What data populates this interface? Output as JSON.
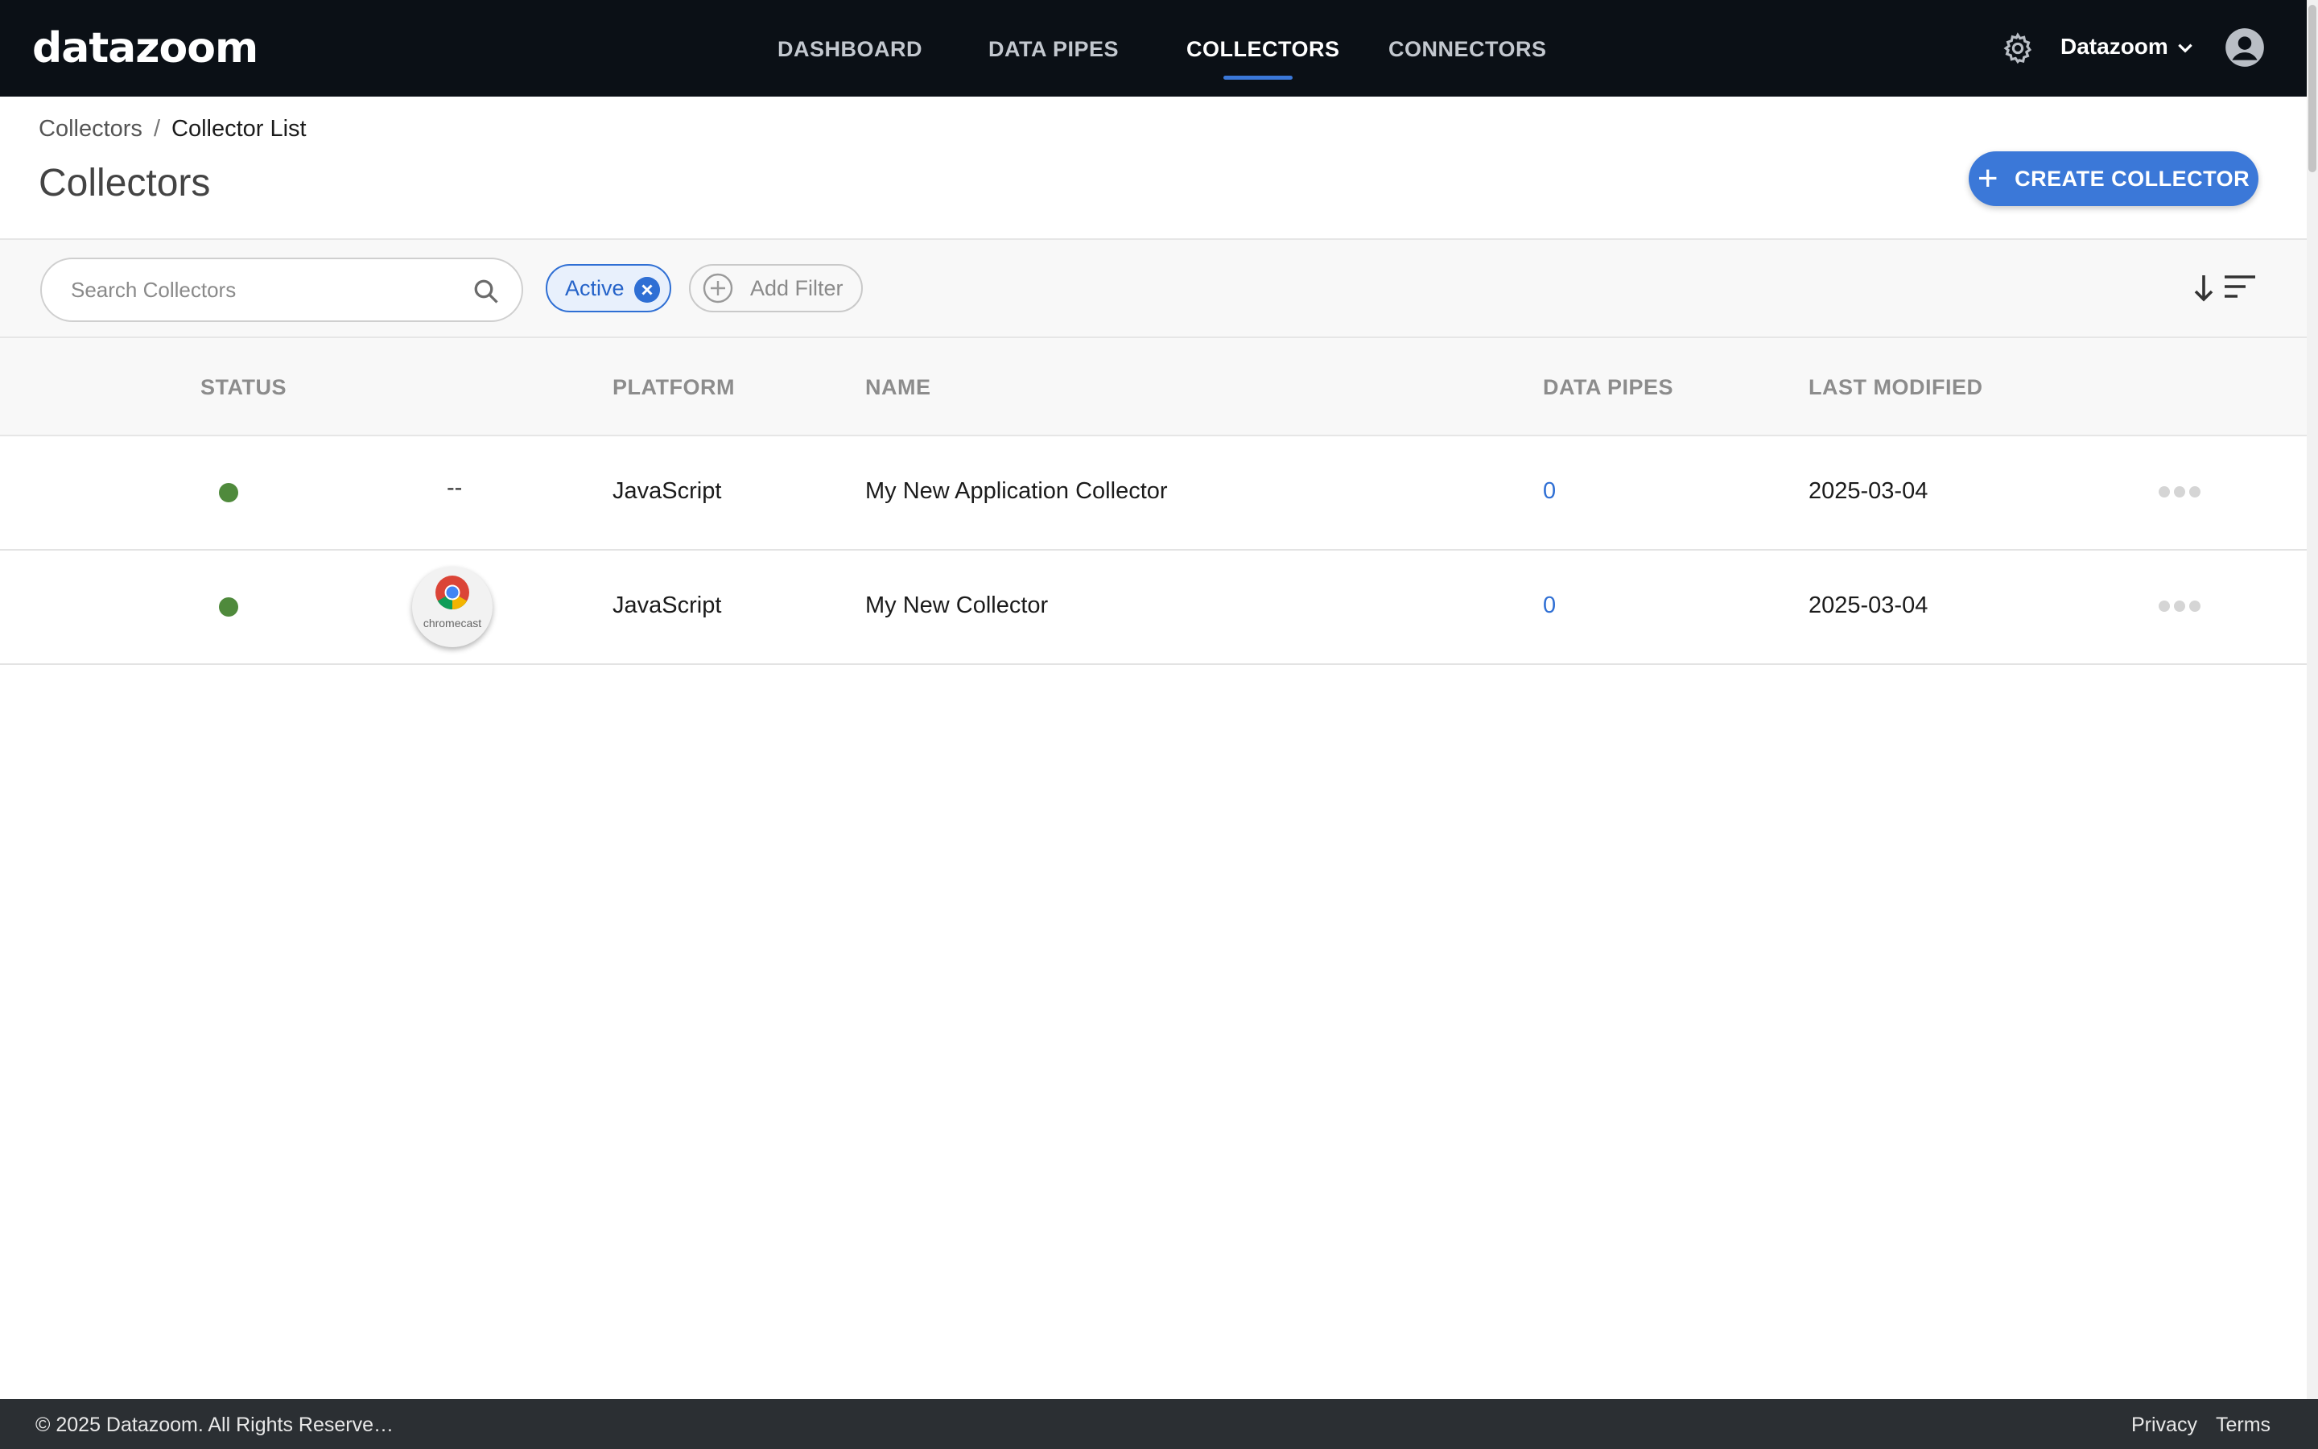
{
  "brand": {
    "logo_text": "datazoom",
    "accent_color": "#3b78d8",
    "nav_bg": "#0b1016"
  },
  "nav": {
    "links": [
      {
        "label": "DASHBOARD"
      },
      {
        "label": "DATA PIPES"
      },
      {
        "label": "COLLECTORS",
        "active": true
      },
      {
        "label": "CONNECTORS"
      }
    ],
    "account_label": "Datazoom",
    "icons": {
      "settings": "gear-icon",
      "account_menu": "chevron-down-icon",
      "avatar": "user-avatar-icon"
    }
  },
  "breadcrumb": {
    "parent": "Collectors",
    "separator": "/",
    "current": "Collector List"
  },
  "page": {
    "title": "Collectors",
    "create_button": "CREATE COLLECTOR"
  },
  "filters": {
    "search_placeholder": "Search Collectors",
    "active_chip": "Active",
    "add_filter": "Add Filter"
  },
  "table": {
    "headers": {
      "status": "STATUS",
      "platform": "PLATFORM",
      "name": "NAME",
      "data_pipes": "DATA PIPES",
      "last_modified": "LAST MODIFIED"
    },
    "rows": [
      {
        "status": "active",
        "platform_logo": "--",
        "platform": "JavaScript",
        "name": "My New Application Collector",
        "data_pipes": "0",
        "last_modified": "2025-03-04"
      },
      {
        "status": "active",
        "platform_logo": "chromecast",
        "platform": "JavaScript",
        "name": "My New Collector",
        "data_pipes": "0",
        "last_modified": "2025-03-04"
      }
    ]
  },
  "footer": {
    "copyright": "© 2025 Datazoom. All Rights Reserve…",
    "privacy": "Privacy",
    "terms": "Terms"
  }
}
